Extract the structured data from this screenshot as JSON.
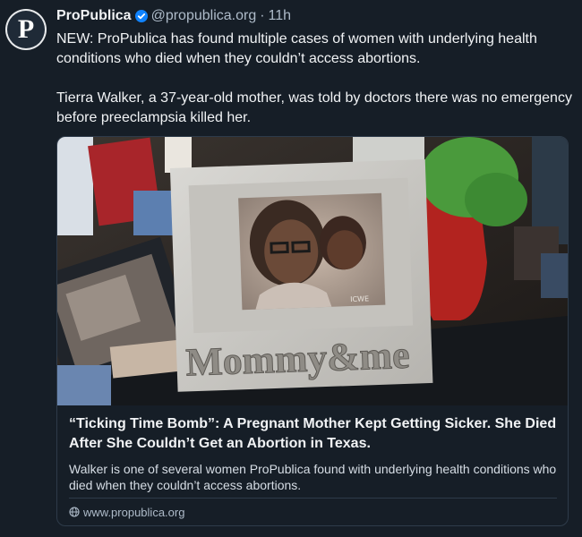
{
  "post": {
    "author_name": "ProPublica",
    "handle": "@propublica.org",
    "separator": "·",
    "time": "11h",
    "avatar_letter": "P",
    "paragraphs": [
      "NEW: ProPublica has found multiple cases of women with underlying health conditions who died when they couldn’t access abortions.",
      "Tierra Walker, a 37-year-old mother, was told by doctors there was no emergency before preeclampsia killed her."
    ]
  },
  "card": {
    "frame_text": "Mommy&me",
    "title": "“Ticking Time Bomb”: A Pregnant Mother Kept Getting Sicker. She Died After She Couldn’t Get an Abortion in Texas.",
    "description": "Walker is one of several women ProPublica found with underlying health conditions who died when they couldn’t access abortions.",
    "link": "www.propublica.org"
  },
  "colors": {
    "background": "#161e27",
    "text": "#f1f3f5",
    "muted": "#aebbc9",
    "verified": "#1083fe",
    "border": "#2e3b4a"
  },
  "icons": [
    "verified-badge-icon",
    "globe-icon"
  ]
}
